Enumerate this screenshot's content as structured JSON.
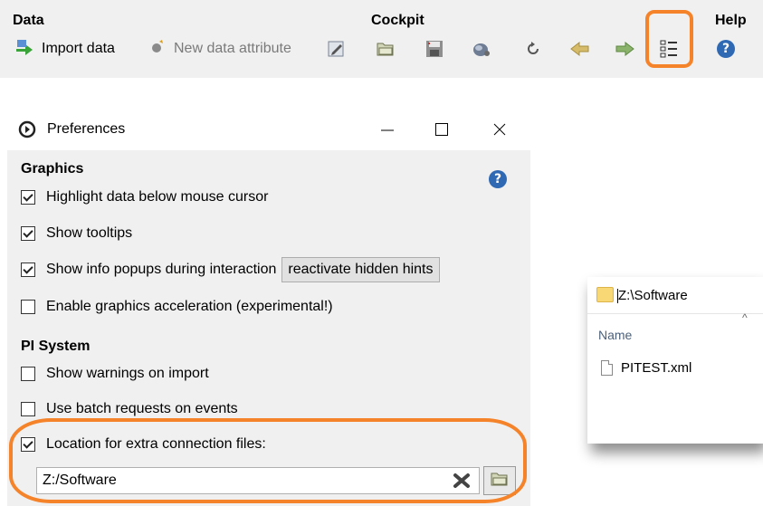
{
  "toolbar": {
    "groups": {
      "data": "Data",
      "cockpit": "Cockpit",
      "help": "Help"
    },
    "import_data_label": "Import data",
    "new_data_attribute_label": "New data attribute",
    "icons": [
      "edit-icon",
      "open-folder-icon",
      "save-icon",
      "cube-icon",
      "undo-icon",
      "back-arrow-icon",
      "forward-arrow-icon",
      "preferences-list-icon",
      "help-icon"
    ]
  },
  "preferences": {
    "title": "Preferences",
    "graphics_section": "Graphics",
    "options": {
      "highlight": {
        "label": "Highlight data below mouse cursor",
        "checked": true
      },
      "tooltips": {
        "label": "Show tooltips",
        "checked": true
      },
      "info_popups": {
        "label": "Show info popups during interaction",
        "checked": true
      },
      "graphics_accel": {
        "label": "Enable graphics acceleration (experimental!)",
        "checked": false
      },
      "warnings_import": {
        "label": "Show warnings on import",
        "checked": false
      },
      "batch_requests": {
        "label": "Use batch requests on events",
        "checked": false
      },
      "extra_conn": {
        "label": "Location for extra connection files:",
        "checked": true
      }
    },
    "reactivate_hints_label": "reactivate hidden hints",
    "pi_section": "PI System",
    "location_value": "Z:/Software"
  },
  "file_dialog": {
    "path": "Z:\\Software",
    "column_name": "Name",
    "files": [
      "PITEST.xml"
    ]
  },
  "colors": {
    "highlight": "#f5832a",
    "help_blue": "#2f69b3"
  }
}
